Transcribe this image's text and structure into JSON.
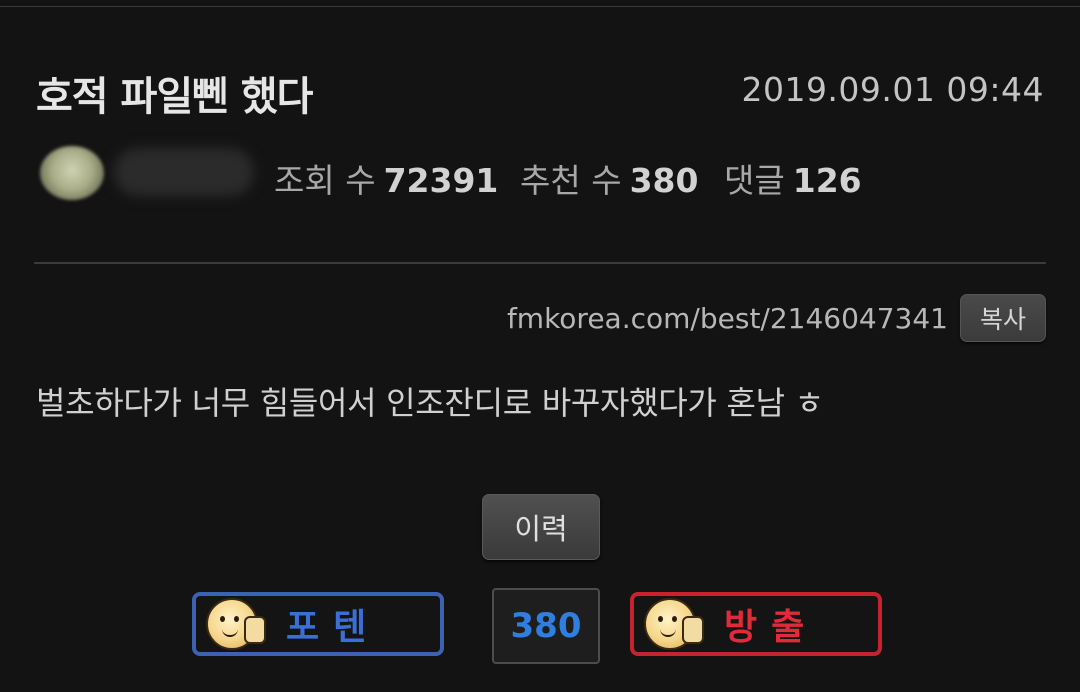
{
  "post": {
    "title": "호적 파일뻰 했다",
    "date": "2019.09.01 09:44",
    "stats": {
      "views_label": "조회 수",
      "views": "72391",
      "recs_label": "추천 수",
      "recs": "380",
      "comments_label": "댓글",
      "comments": "126"
    },
    "url": "fmkorea.com/best/2146047341",
    "copy_label": "복사",
    "body": "벌초하다가 너무 힘들어서 인조잔디로 바꾸자했다가 혼남 ㅎ",
    "history_label": "이력",
    "vote": {
      "up_label": "포텐",
      "count": "380",
      "down_label": "방출"
    }
  },
  "colors": {
    "background": "#131314",
    "vote_up": "#3c62b4",
    "vote_down": "#c8222f",
    "count": "#2f7fe0"
  }
}
